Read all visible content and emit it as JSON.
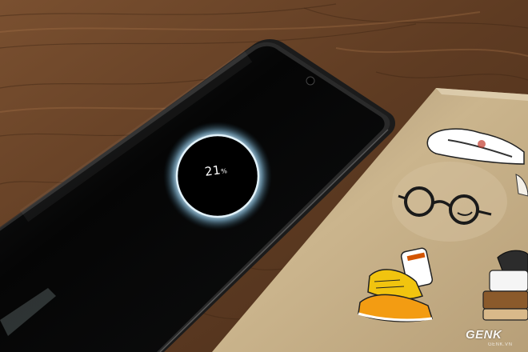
{
  "battery": {
    "level": "21",
    "unit": "%"
  },
  "watermark": {
    "brand": "GENK",
    "site": "GENK.VN"
  },
  "colors": {
    "table_wood": "#6b4428",
    "phone_body": "#0b0b0b",
    "ring_glow": "#bfe6ff",
    "notebook_cover": "#c6b088"
  },
  "icons": [
    "sneaker-sticker",
    "glasses-sticker",
    "sneakers-with-socks-sticker",
    "mug-sticker",
    "camera-punch-hole"
  ]
}
